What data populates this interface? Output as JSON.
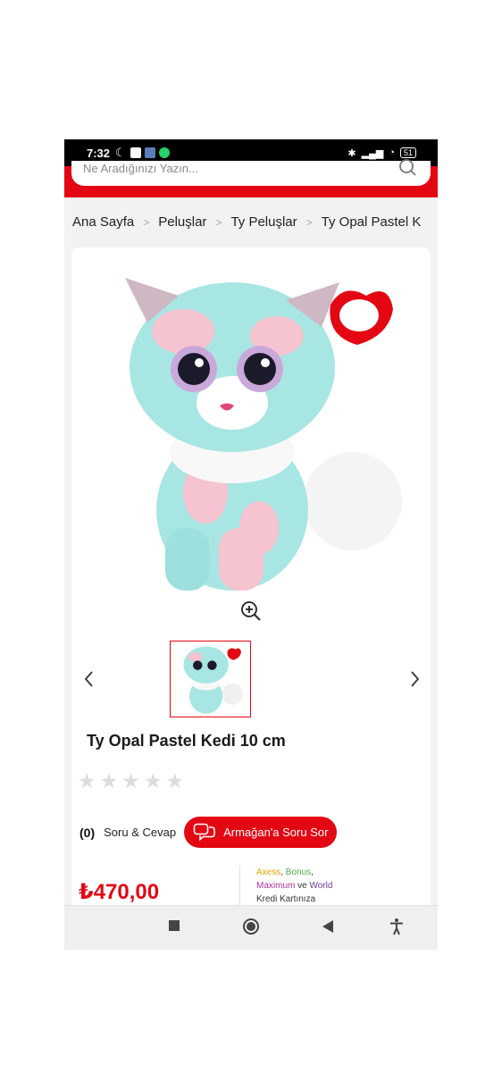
{
  "status_bar": {
    "time": "7:32",
    "battery": "51"
  },
  "search": {
    "placeholder": "Ne Aradığınızı Yazın..."
  },
  "breadcrumb": [
    "Ana Sayfa",
    "Peluşlar",
    "Ty Peluşlar",
    "Ty Opal Pastel K"
  ],
  "product": {
    "title": "Ty Opal Pastel Kedi 10 cm",
    "rating": 0,
    "rating_max": 5,
    "qa_count": "(0)",
    "qa_label": "Soru & Cevap",
    "ask_button_label": "Armağan'a Soru Sor",
    "price": "₺470,00"
  },
  "card_offer": {
    "axess": "Axess",
    "bonus": "Bonus",
    "maximum": "Maximum",
    "and": "ve",
    "world": "World",
    "suffix": "Kredi Kartınıza"
  },
  "colors": {
    "brand": "#e30613",
    "background": "#f2f2f2"
  },
  "icons": [
    "search-icon",
    "zoom-in-icon",
    "chevron-left-icon",
    "chevron-right-icon",
    "chat-icon",
    "star-icon",
    "nav-square-icon",
    "nav-home-icon",
    "nav-back-icon",
    "accessibility-icon"
  ]
}
